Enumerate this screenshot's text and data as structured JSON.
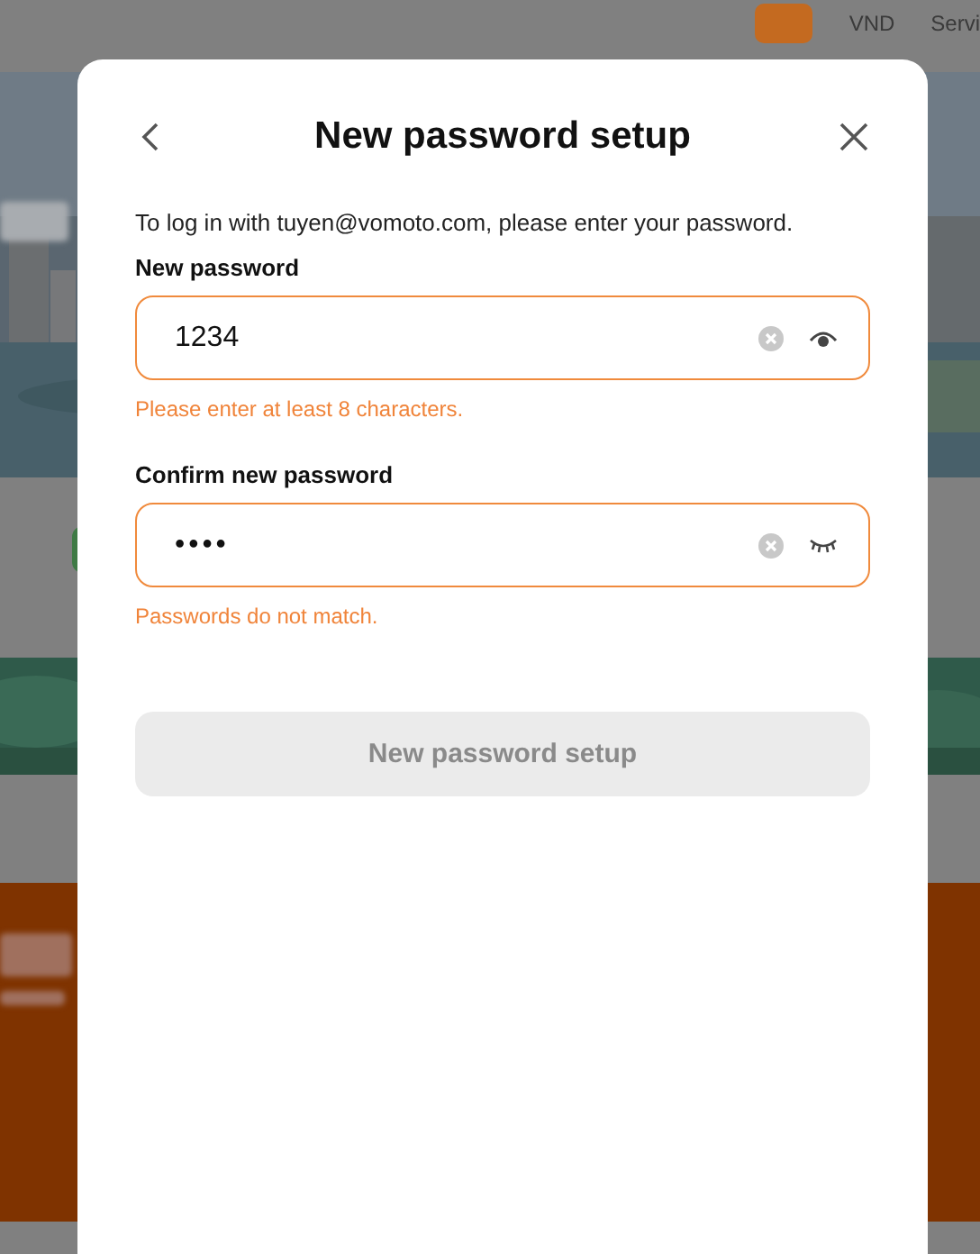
{
  "background": {
    "header": {
      "currency": "VND",
      "menu_item": "Servi"
    }
  },
  "dialog": {
    "title": "New password setup",
    "intro": "To log in with tuyen@vomoto.com, please enter your password.",
    "fields": [
      {
        "label": "New password",
        "value": "1234",
        "visible": true,
        "error": "Please enter at least 8 characters."
      },
      {
        "label": "Confirm new password",
        "value": "••••",
        "visible": false,
        "error": "Passwords do not match."
      }
    ],
    "submit": {
      "label": "New password setup",
      "disabled": true
    }
  }
}
